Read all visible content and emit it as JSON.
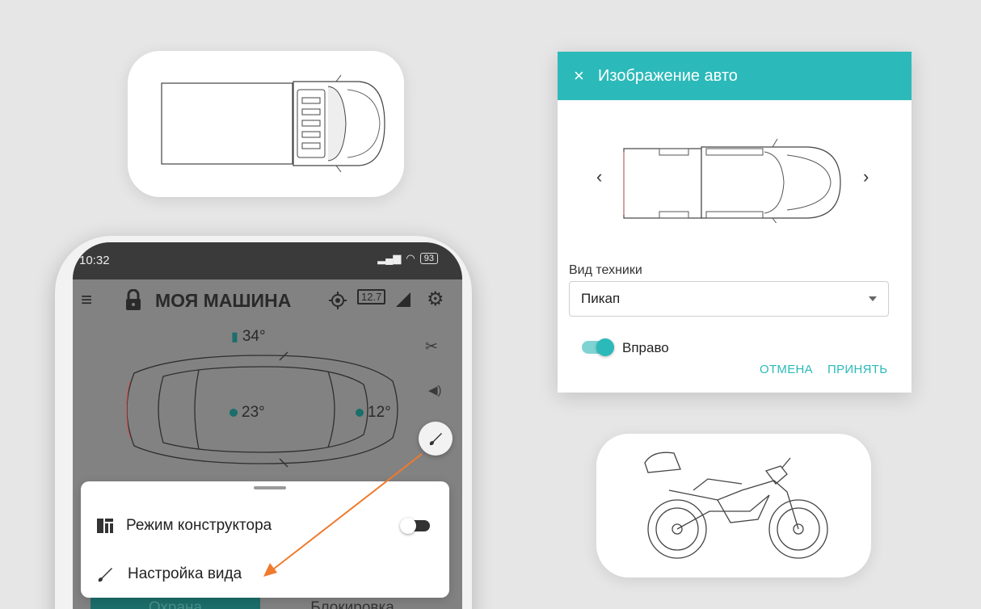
{
  "dialog": {
    "title": "Изображение авто",
    "vehicle_type_label": "Вид техники",
    "vehicle_type_value": "Пикап",
    "direction_label": "Вправо",
    "direction_on": true,
    "cancel": "ОТМЕНА",
    "accept": "ПРИНЯТЬ",
    "prev": "‹",
    "next": "›",
    "close": "×",
    "accent_color": "#2bbab9"
  },
  "phone": {
    "status_time": "10:32",
    "battery": "93",
    "app_title": "МОЯ МАШИНА",
    "battery_voltage": "12.7",
    "outside_temp": "34°",
    "cabin_temp": "23°",
    "engine_temp": "12°",
    "tab_guard": "Охрана",
    "tab_block": "Блокировка"
  },
  "sheet": {
    "constructor_mode": "Режим конструктора",
    "constructor_mode_on": false,
    "view_settings": "Настройка вида"
  },
  "annotation_color": "#f07a2c"
}
